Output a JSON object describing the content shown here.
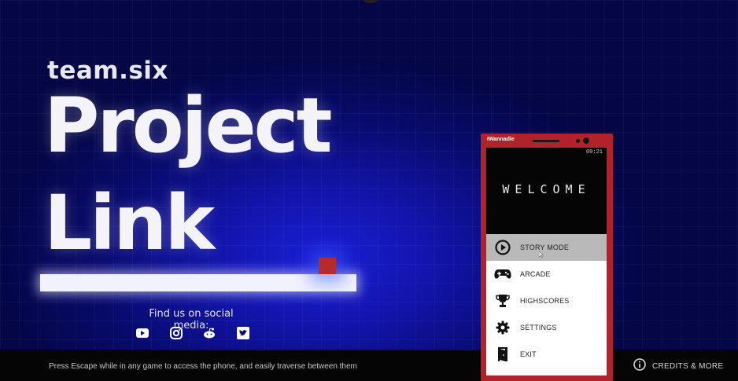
{
  "game": {
    "studio": "team.six",
    "title_line1": "Project",
    "title_line2": "Link"
  },
  "social": {
    "label": "Find us on social media:",
    "icons": [
      "youtube-icon",
      "instagram-icon",
      "reddit-icon",
      "twitter-icon"
    ]
  },
  "footer": {
    "hint": "Press Escape while in any game to access the phone, and easily traverse between them",
    "credits_label": "CREDITS & MORE"
  },
  "phone": {
    "brand": "IWannadie",
    "clock": "09:21",
    "welcome": "WELCOME",
    "menu": [
      {
        "label": "STORY MODE",
        "icon": "play-icon",
        "active": true
      },
      {
        "label": "ARCADE",
        "icon": "gamepad-icon",
        "active": false
      },
      {
        "label": "HIGHSCORES",
        "icon": "trophy-icon",
        "active": false
      },
      {
        "label": "SETTINGS",
        "icon": "gear-icon",
        "active": false
      },
      {
        "label": "EXIT",
        "icon": "exit-door-icon",
        "active": false
      }
    ],
    "frame_color": "#b3212a"
  },
  "colors": {
    "background": "#080a6b",
    "platform": "#f2f2ff",
    "cube": "#b52a2a"
  }
}
